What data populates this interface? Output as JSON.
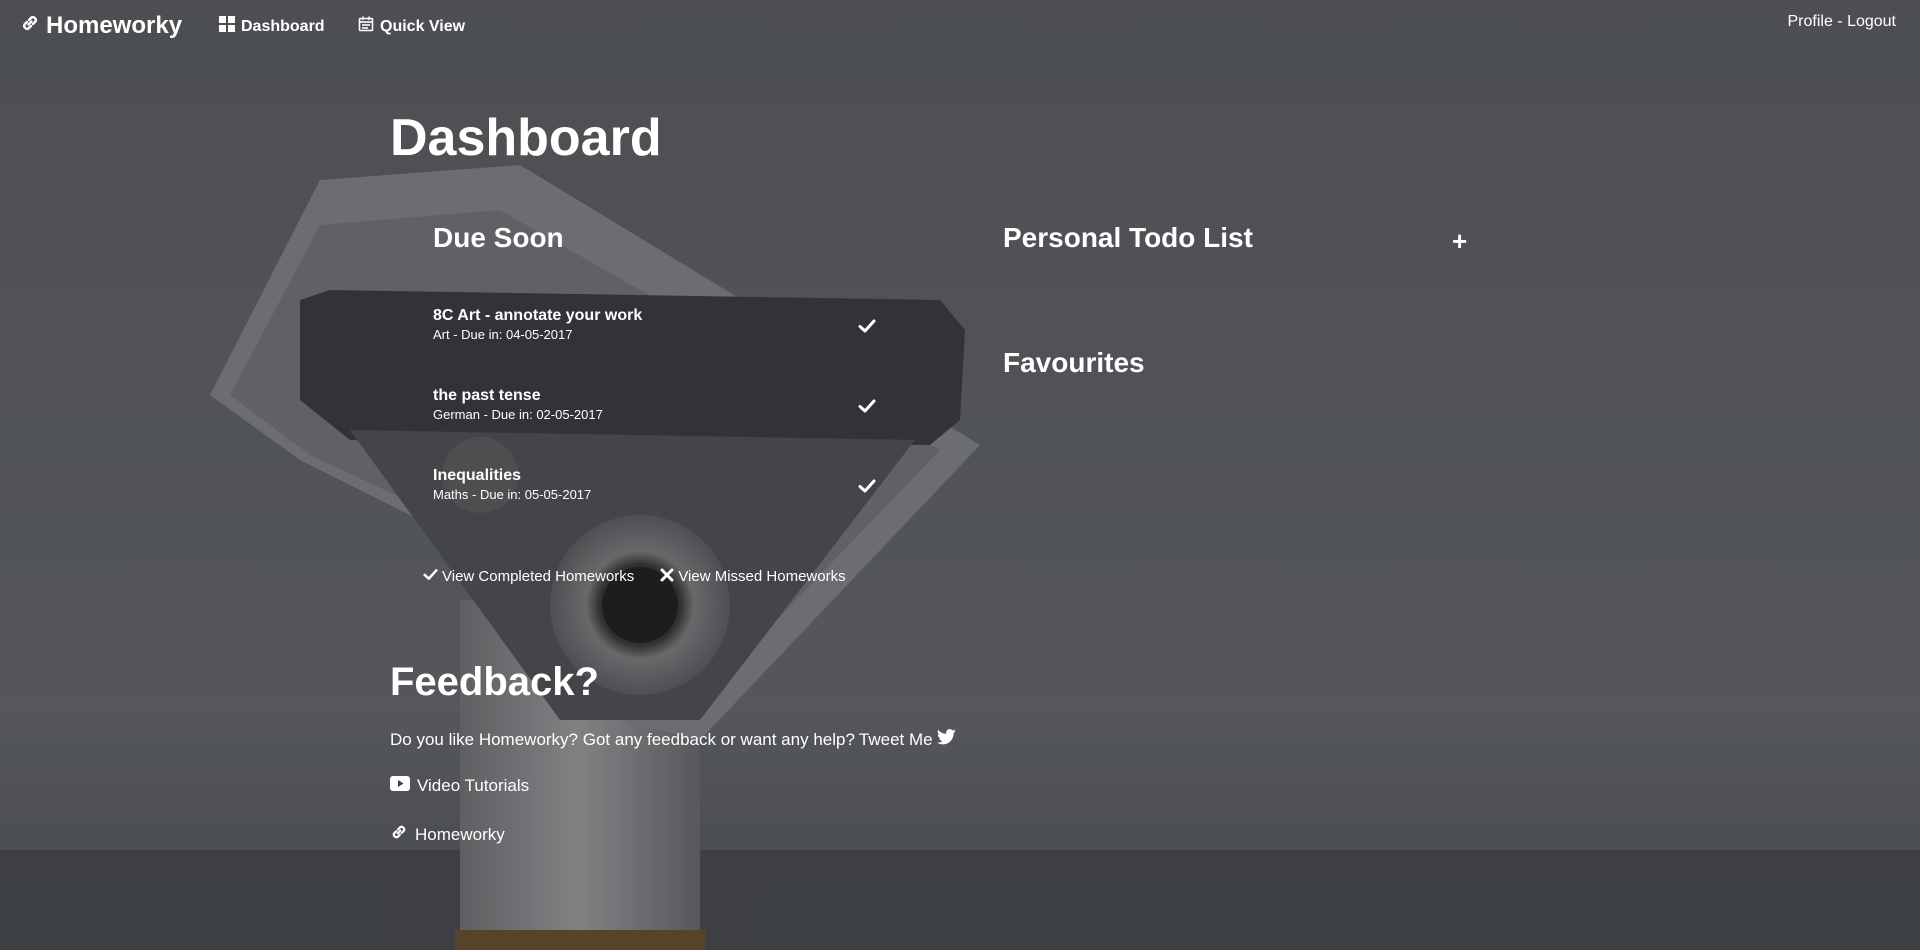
{
  "navbar": {
    "brand": "Homeworky",
    "dashboard_label": "Dashboard",
    "quickview_label": "Quick View",
    "profile_label": "Profile",
    "separator": " - ",
    "logout_label": "Logout"
  },
  "page": {
    "title": "Dashboard"
  },
  "due_soon": {
    "title": "Due Soon",
    "items": [
      {
        "title": "8C Art - annotate your work",
        "meta": "Art - Due in: 04-05-2017"
      },
      {
        "title": "the past tense",
        "meta": "German - Due in: 02-05-2017"
      },
      {
        "title": "Inequalities",
        "meta": "Maths - Due in: 05-05-2017"
      }
    ],
    "view_completed_label": "View Completed Homeworks",
    "view_missed_label": "View Missed Homeworks"
  },
  "todo": {
    "title": "Personal Todo List",
    "add_label": "+"
  },
  "favourites": {
    "title": "Favourites"
  },
  "feedback": {
    "title": "Feedback?",
    "text": "Do you like Homeworky? Got any feedback or want any help?",
    "tweet_label": "Tweet Me",
    "video_label": "Video Tutorials",
    "home_label": "Homeworky"
  },
  "icons": {
    "brand": "link-icon",
    "dashboard": "grid-icon",
    "quickview": "calendar-icon",
    "check": "check-icon",
    "cross": "close-icon",
    "twitter": "twitter-icon",
    "youtube": "youtube-icon"
  },
  "colors": {
    "text": "#ffffff",
    "overlay": "#3a3b3d"
  }
}
